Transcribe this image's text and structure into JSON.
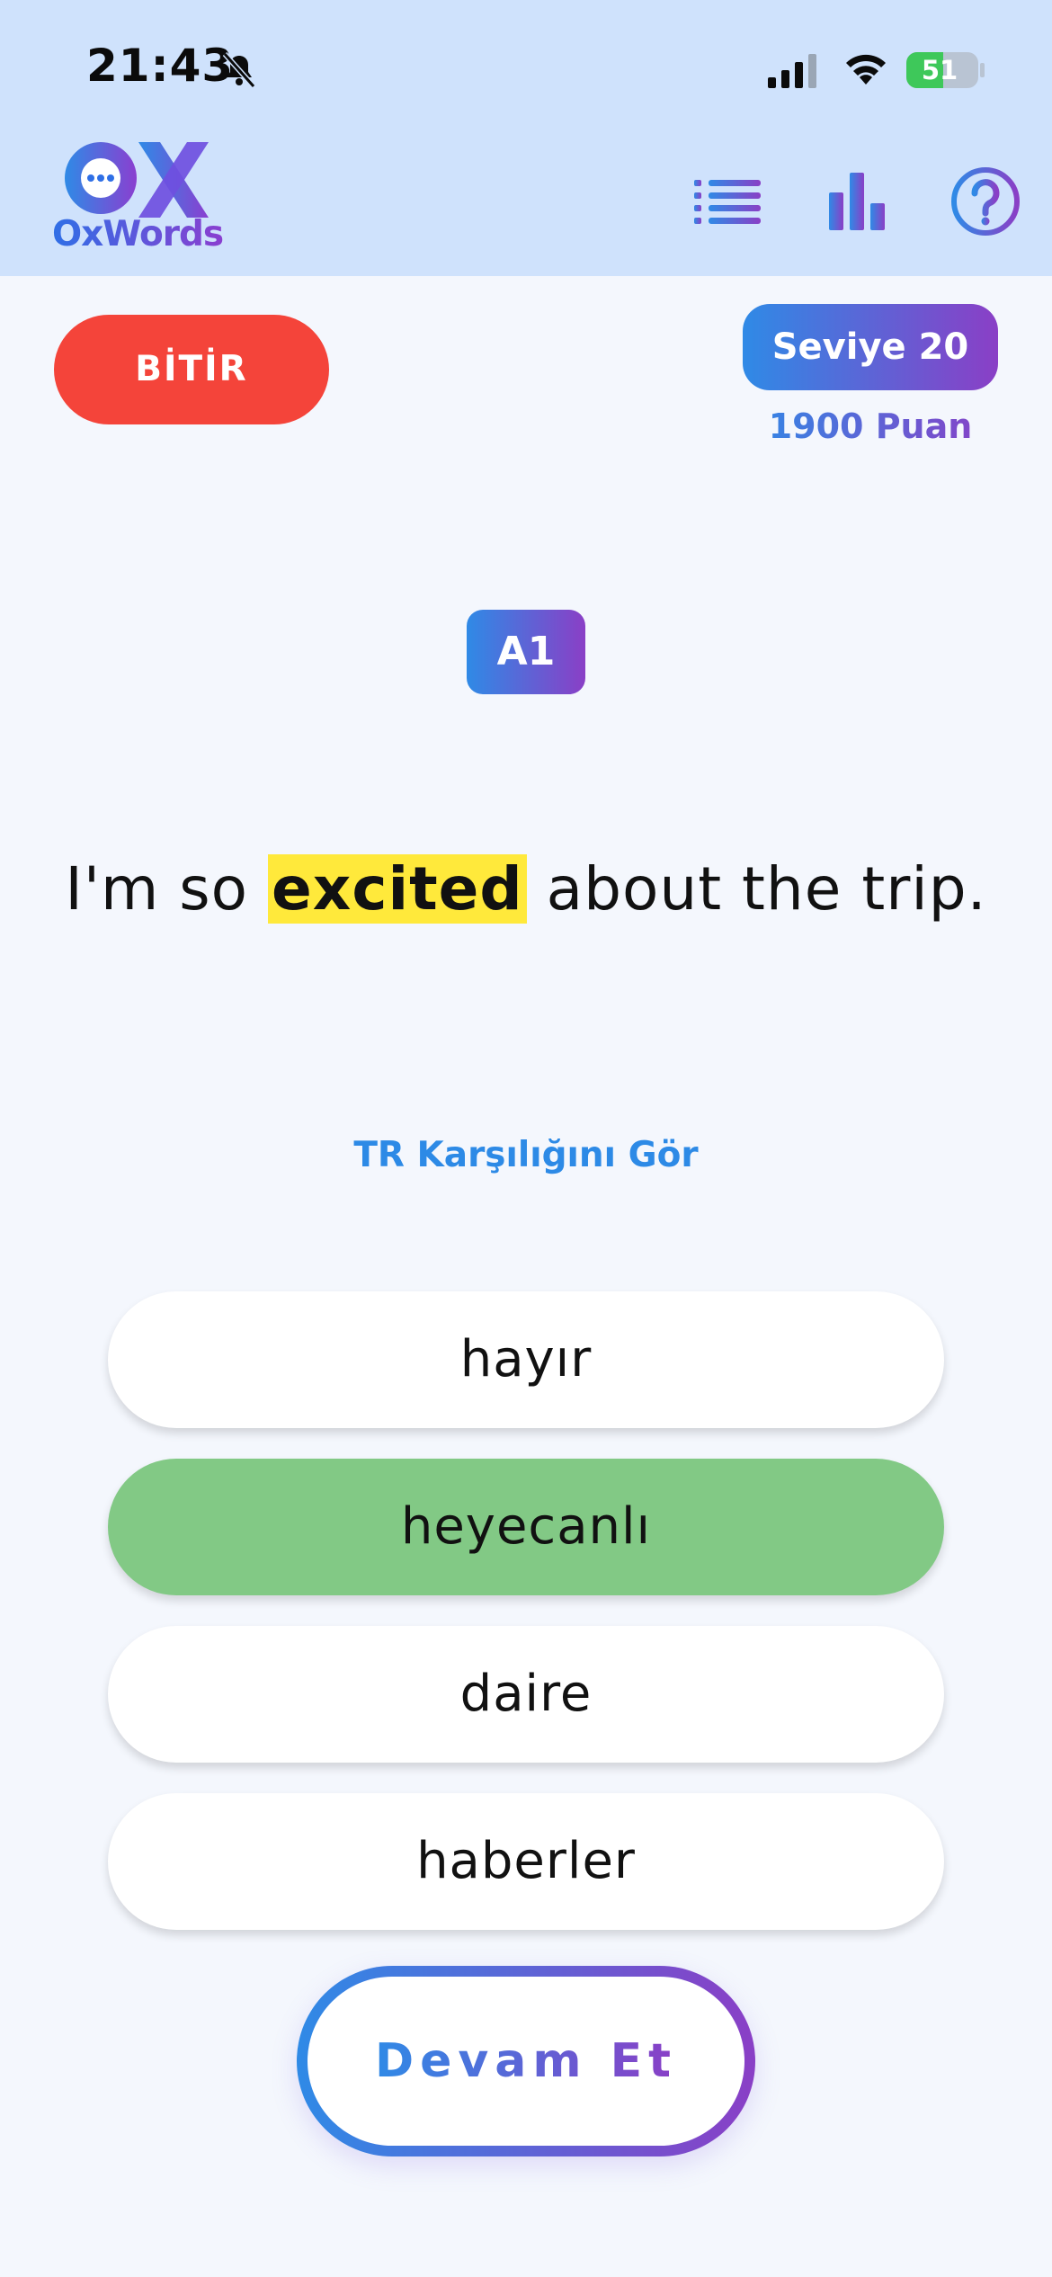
{
  "status_bar": {
    "time": "21:43",
    "battery": "51",
    "battery_level": 0.51
  },
  "header": {
    "logo_text": "OxWords",
    "icons": [
      "list-icon",
      "bar-chart-icon",
      "help-icon"
    ]
  },
  "session": {
    "finish_label": "BİTİR",
    "level_label": "Seviye 20",
    "points_label": "1900 Puan"
  },
  "question": {
    "cefr_level": "A1",
    "sentence_before": "I'm so ",
    "target_word": "excited",
    "sentence_after": " about the trip.",
    "translate_link": "TR Karşılığını Gör"
  },
  "options": [
    {
      "label": "hayır",
      "state": "default"
    },
    {
      "label": "heyecanlı",
      "state": "correct"
    },
    {
      "label": "daire",
      "state": "default"
    },
    {
      "label": "haberler",
      "state": "default"
    }
  ],
  "continue_label": "Devam Et",
  "colors": {
    "header_bg": "#cfe2fc",
    "finish_red": "#f4443a",
    "gradient_start": "#2f8ae6",
    "gradient_end": "#8a3fc6",
    "highlight_yellow": "#ffe93b",
    "correct_green": "#82c985"
  }
}
